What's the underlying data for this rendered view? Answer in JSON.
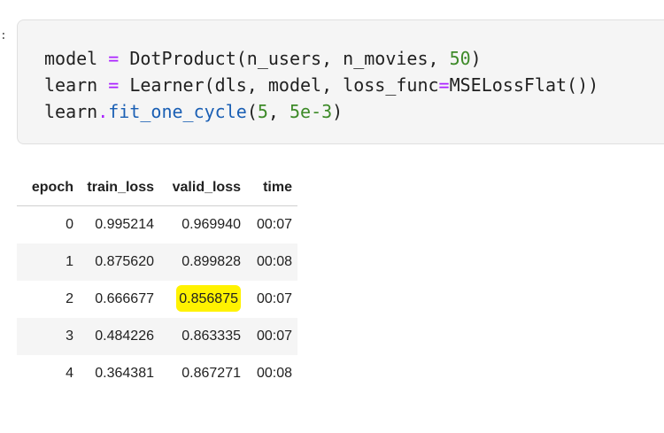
{
  "cell": {
    "prompt_mark": ":",
    "code_lines": [
      [
        {
          "t": "model ",
          "c": ""
        },
        {
          "t": "=",
          "c": "op"
        },
        {
          "t": " DotProduct(n_users, n_movies, ",
          "c": ""
        },
        {
          "t": "50",
          "c": "num"
        },
        {
          "t": ")",
          "c": ""
        }
      ],
      [
        {
          "t": "learn ",
          "c": ""
        },
        {
          "t": "=",
          "c": "op"
        },
        {
          "t": " Learner(dls, model, loss_func",
          "c": ""
        },
        {
          "t": "=",
          "c": "op"
        },
        {
          "t": "MSELossFlat())",
          "c": ""
        }
      ],
      [
        {
          "t": "learn",
          "c": ""
        },
        {
          "t": ".",
          "c": "op"
        },
        {
          "t": "fit_one_cycle",
          "c": "fn"
        },
        {
          "t": "(",
          "c": ""
        },
        {
          "t": "5",
          "c": "num"
        },
        {
          "t": ", ",
          "c": ""
        },
        {
          "t": "5e-3",
          "c": "num"
        },
        {
          "t": ")",
          "c": ""
        }
      ]
    ]
  },
  "output_table": {
    "columns": [
      "epoch",
      "train_loss",
      "valid_loss",
      "time"
    ],
    "rows": [
      {
        "epoch": "0",
        "train_loss": "0.995214",
        "valid_loss": "0.969940",
        "time": "00:07"
      },
      {
        "epoch": "1",
        "train_loss": "0.875620",
        "valid_loss": "0.899828",
        "time": "00:08"
      },
      {
        "epoch": "2",
        "train_loss": "0.666677",
        "valid_loss": "0.856875",
        "time": "00:07"
      },
      {
        "epoch": "3",
        "train_loss": "0.484226",
        "valid_loss": "0.863335",
        "time": "00:07"
      },
      {
        "epoch": "4",
        "train_loss": "0.364381",
        "valid_loss": "0.867271",
        "time": "00:08"
      }
    ],
    "highlight": {
      "row_index": 2,
      "column": "valid_loss",
      "color": "#fff200"
    }
  },
  "colors": {
    "operator": "#aa22ff",
    "function": "#1a5fb4",
    "number": "#3d8a28",
    "cell_background": "#f5f5f5"
  }
}
